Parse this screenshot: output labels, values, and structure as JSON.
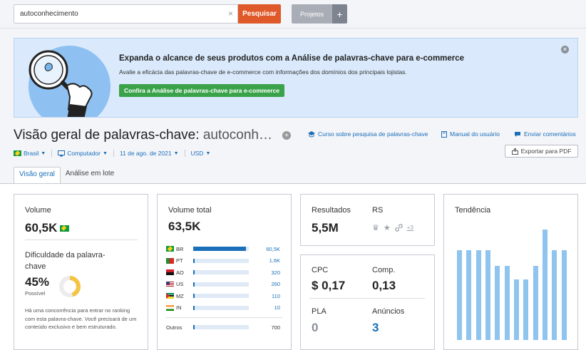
{
  "search": {
    "value": "autoconhecimento",
    "button": "Pesquisar"
  },
  "projects": {
    "label": "Projetos",
    "plus": "+"
  },
  "banner": {
    "title": "Expanda o alcance de seus produtos com a Análise de palavras-chave para e-commerce",
    "text": "Avalie a eficácia das palavras-chave de e-commerce com informações dos domínios dos principais lojistas.",
    "cta": "Confira a Análise de palavras-chave para e-commerce"
  },
  "header": {
    "title": "Visão geral de palavras-chave:",
    "keyword": "autoconh…",
    "links": [
      "Curso sobre pesquisa de palavras-chave",
      "Manual do usuário",
      "Enviar comentários"
    ],
    "export": "Exportar para PDF"
  },
  "filters": {
    "country": "Brasil",
    "device": "Computador",
    "date": "11 de ago. de 2021",
    "currency": "USD"
  },
  "tabs": [
    "Visão geral",
    "Análise em lote"
  ],
  "volume": {
    "label": "Volume",
    "value": "60,5K"
  },
  "difficulty": {
    "label": "Dificuldade da palavra-chave",
    "value": "45%",
    "level": "Possível",
    "percent": 45,
    "description": "Há uma concorrência para entrar no ranking com esta palavra-chave. Você precisará de um conteúdo exclusivo e bem estruturado."
  },
  "total_volume": {
    "label": "Volume total",
    "value": "63,5K",
    "rows": [
      {
        "code": "BR",
        "flag": "br",
        "value": "60,5K",
        "share": 0.95
      },
      {
        "code": "PT",
        "flag": "pt",
        "value": "1,6K",
        "share": 0.025
      },
      {
        "code": "AO",
        "flag": "ao",
        "value": "320",
        "share": 0.01
      },
      {
        "code": "US",
        "flag": "us",
        "value": "260",
        "share": 0.008
      },
      {
        "code": "MZ",
        "flag": "mz",
        "value": "110",
        "share": 0.005
      },
      {
        "code": "IN",
        "flag": "in",
        "value": "10",
        "share": 0.002
      }
    ],
    "others": {
      "label": "Outros",
      "value": "700",
      "share": 0.011
    }
  },
  "results": {
    "label": "Resultados",
    "value": "5,5M",
    "rs_label": "RS",
    "rs_more": "+3"
  },
  "cpc": {
    "label": "CPC",
    "value": "$ 0,17"
  },
  "comp": {
    "label": "Comp.",
    "value": "0,13"
  },
  "pla": {
    "label": "PLA",
    "value": "0"
  },
  "ads": {
    "label": "Anúncios",
    "value": "3"
  },
  "trend": {
    "label": "Tendência",
    "values": [
      0.81,
      0.81,
      0.81,
      0.81,
      0.67,
      0.67,
      0.55,
      0.55,
      0.67,
      1.0,
      0.81,
      0.81
    ]
  },
  "colors": {
    "accent": "#1a6fb8",
    "search_button": "#e0592a",
    "cta": "#3aa34a",
    "trend_bar": "#8ec4ee",
    "difficulty": "#f6c445"
  }
}
